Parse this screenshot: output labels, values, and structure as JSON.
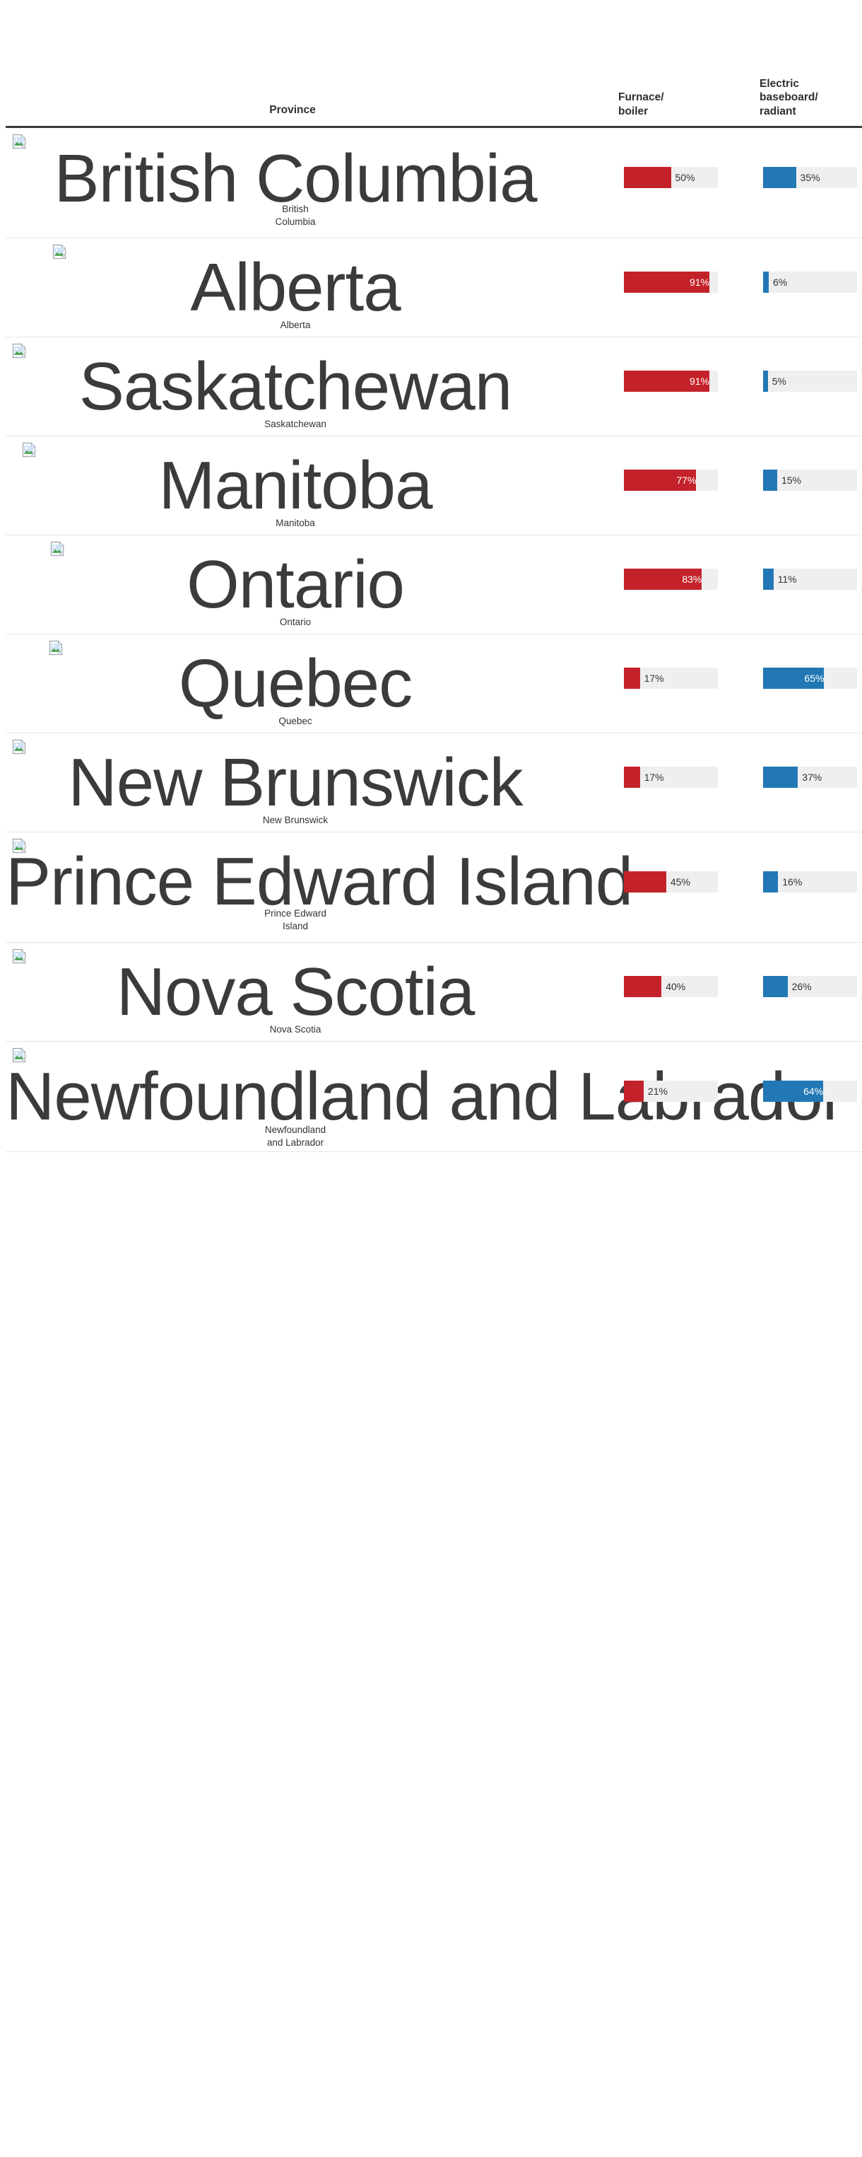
{
  "header": {
    "province_label": "Province",
    "furnace_label": "Furnace/\nboiler",
    "furnace_line1": "Furnace/",
    "furnace_line2": "boiler",
    "electric_line1": "Electric",
    "electric_line2": "baseboard/",
    "electric_line3": "radiant"
  },
  "colors": {
    "furnace_bar": "#C4222A",
    "electric_bar": "#2278B4",
    "bar_track": "#efefef",
    "header_rule": "#3a3a3a",
    "row_rule": "#e6e6e6",
    "text": "#333333"
  },
  "icons": {
    "broken_image": "broken-image-icon"
  },
  "chart_data": {
    "type": "bar",
    "title": "",
    "categories": [
      "British Columbia",
      "Alberta",
      "Saskatchewan",
      "Manitoba",
      "Ontario",
      "Quebec",
      "New Brunswick",
      "Prince Edward Island",
      "Nova Scotia",
      "Newfoundland and Labrador"
    ],
    "series": [
      {
        "name": "Furnace/boiler",
        "color": "#C4222A",
        "values": [
          50,
          91,
          91,
          77,
          83,
          17,
          17,
          45,
          40,
          21
        ]
      },
      {
        "name": "Electric baseboard/radiant",
        "color": "#2278B4",
        "values": [
          35,
          6,
          5,
          15,
          11,
          65,
          37,
          16,
          26,
          64
        ]
      }
    ],
    "xlabel": "",
    "ylabel": "",
    "xlim": [
      0,
      100
    ],
    "grid": false,
    "legend": "none",
    "value_suffix": "%"
  },
  "rows": [
    {
      "alt_text": "British Columbia",
      "caption_line1": "British",
      "caption_line2": "Columbia",
      "furnace": {
        "value": 50,
        "label": "50%",
        "inside": false
      },
      "electric": {
        "value": 35,
        "label": "35%",
        "inside": false
      }
    },
    {
      "alt_text": "Alberta",
      "caption_line1": "Alberta",
      "caption_line2": "",
      "furnace": {
        "value": 91,
        "label": "91%",
        "inside": true
      },
      "electric": {
        "value": 6,
        "label": "6%",
        "inside": false
      }
    },
    {
      "alt_text": "Saskatchewan",
      "caption_line1": "Saskatchewan",
      "caption_line2": "",
      "furnace": {
        "value": 91,
        "label": "91%",
        "inside": true
      },
      "electric": {
        "value": 5,
        "label": "5%",
        "inside": false
      }
    },
    {
      "alt_text": "Manitoba",
      "caption_line1": "Manitoba",
      "caption_line2": "",
      "furnace": {
        "value": 77,
        "label": "77%",
        "inside": true
      },
      "electric": {
        "value": 15,
        "label": "15%",
        "inside": false
      }
    },
    {
      "alt_text": "Ontario",
      "caption_line1": "Ontario",
      "caption_line2": "",
      "furnace": {
        "value": 83,
        "label": "83%",
        "inside": true
      },
      "electric": {
        "value": 11,
        "label": "11%",
        "inside": false
      }
    },
    {
      "alt_text": "Quebec",
      "caption_line1": "Quebec",
      "caption_line2": "",
      "furnace": {
        "value": 17,
        "label": "17%",
        "inside": false
      },
      "electric": {
        "value": 65,
        "label": "65%",
        "inside": true
      }
    },
    {
      "alt_text": "New Brunswick",
      "caption_line1": "New Brunswick",
      "caption_line2": "",
      "furnace": {
        "value": 17,
        "label": "17%",
        "inside": false
      },
      "electric": {
        "value": 37,
        "label": "37%",
        "inside": false
      }
    },
    {
      "alt_text": "Prince Edward Island",
      "caption_line1": "Prince Edward",
      "caption_line2": "Island",
      "furnace": {
        "value": 45,
        "label": "45%",
        "inside": false
      },
      "electric": {
        "value": 16,
        "label": "16%",
        "inside": false
      }
    },
    {
      "alt_text": "Nova Scotia",
      "caption_line1": "Nova Scotia",
      "caption_line2": "",
      "furnace": {
        "value": 40,
        "label": "40%",
        "inside": false
      },
      "electric": {
        "value": 26,
        "label": "26%",
        "inside": false
      }
    },
    {
      "alt_text": "Newfoundland and Labrador",
      "caption_line1": "Newfoundland",
      "caption_line2": "and Labrador",
      "furnace": {
        "value": 21,
        "label": "21%",
        "inside": false
      },
      "electric": {
        "value": 64,
        "label": "64%",
        "inside": true
      }
    }
  ],
  "layout": {
    "row_geometry": [
      {
        "height": 156,
        "icon_left": 8,
        "alt_top": 24,
        "alt_font": 96,
        "cap_top": 106
      },
      {
        "height": 140,
        "icon_left": 65,
        "alt_top": 22,
        "alt_font": 96,
        "cap_top": 114
      },
      {
        "height": 140,
        "icon_left": 8,
        "alt_top": 22,
        "alt_font": 96,
        "cap_top": 114
      },
      {
        "height": 140,
        "icon_left": 22,
        "alt_top": 22,
        "alt_font": 96,
        "cap_top": 114
      },
      {
        "height": 140,
        "icon_left": 62,
        "alt_top": 22,
        "alt_font": 96,
        "cap_top": 114
      },
      {
        "height": 140,
        "icon_left": 60,
        "alt_top": 22,
        "alt_font": 96,
        "cap_top": 114
      },
      {
        "height": 140,
        "icon_left": 8,
        "alt_top": 22,
        "alt_font": 96,
        "cap_top": 114
      },
      {
        "height": 156,
        "icon_left": 8,
        "alt_top": 22,
        "alt_font": 96,
        "cap_top": 106
      },
      {
        "height": 140,
        "icon_left": 8,
        "alt_top": 22,
        "alt_font": 96,
        "cap_top": 114
      },
      {
        "height": 156,
        "icon_left": 8,
        "alt_top": 30,
        "alt_font": 96,
        "cap_top": 116
      }
    ]
  }
}
